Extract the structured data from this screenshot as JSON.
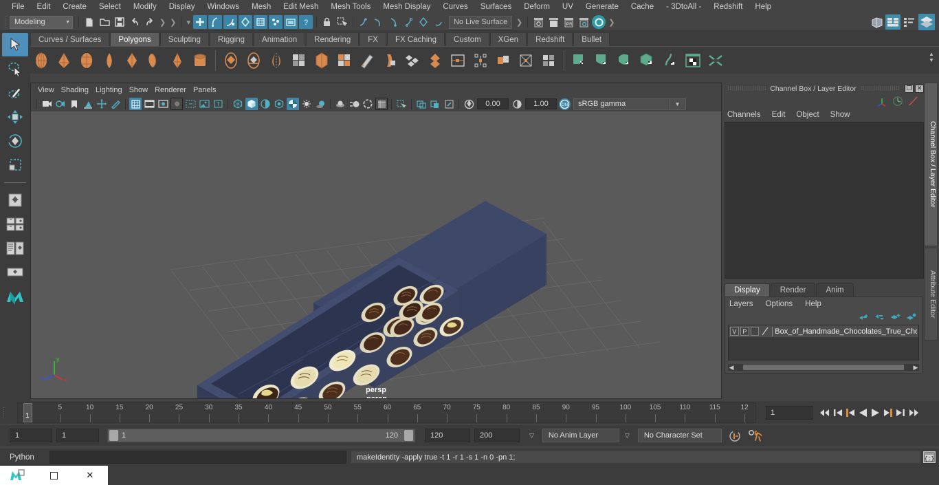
{
  "app": {
    "name": "Autodesk Maya",
    "viewport_camera_label": "persp"
  },
  "menubar": {
    "items": [
      "File",
      "Edit",
      "Create",
      "Select",
      "Modify",
      "Display",
      "Windows",
      "Mesh",
      "Edit Mesh",
      "Mesh Tools",
      "Mesh Display",
      "Curves",
      "Surfaces",
      "Deform",
      "UV",
      "Generate",
      "Cache",
      "- 3DtoAll -",
      "Redshift",
      "Help"
    ]
  },
  "statusbar": {
    "workspace": "Modeling",
    "live_surface": "No Live Surface",
    "icons": [
      "new-scene-icon",
      "open-scene-icon",
      "save-scene-icon",
      "undo-icon",
      "redo-icon",
      "select-by-hierarchy-icon",
      "select-by-object-icon",
      "select-by-component-icon",
      "snap-grid-icon",
      "snap-curve-icon",
      "snap-point-icon",
      "snap-projected-icon",
      "snap-view-plane-icon",
      "make-live-icon",
      "lock-icon",
      "selection-mask-icon",
      "render-current-frame-icon",
      "ipr-render-icon",
      "render-settings-icon",
      "hypershade-icon",
      "render-view-icon",
      "show-hide-editors-icon",
      "attribute-editor-toggle-icon",
      "tool-settings-toggle-icon",
      "channel-box-toggle-icon"
    ]
  },
  "shelf": {
    "tabs": [
      "Curves / Surfaces",
      "Polygons",
      "Sculpting",
      "Rigging",
      "Animation",
      "Rendering",
      "FX",
      "FX Caching",
      "Custom",
      "XGen",
      "Redshift",
      "Bullet"
    ],
    "active_tab": "Polygons",
    "buttons": [
      "poly-sphere-icon",
      "poly-cone-icon",
      "poly-cube-icon",
      "poly-cylinder-icon",
      "poly-torus-icon",
      "poly-plane-icon",
      "poly-pyramid-icon",
      "poly-pipe-icon",
      "poly-boolean-union-icon",
      "poly-boolean-difference-icon",
      "poly-mirror-icon",
      "poly-combine-icon",
      "poly-smooth-icon",
      "poly-multi-cut-icon",
      "poly-sculpt-icon",
      "poly-extrude-icon",
      "poly-bevel-icon",
      "poly-bridge-icon",
      "poly-merge-icon",
      "poly-append-icon",
      "poly-wedge-icon",
      "poly-duplicate-face-icon",
      "poly-transform-icon",
      "poly-quad-draw-icon",
      "uv-planar-icon",
      "uv-cylindrical-icon",
      "uv-spherical-icon",
      "uv-automatic-icon",
      "uv-unfold-icon",
      "uv-editor-icon",
      "uv-layout-icon"
    ]
  },
  "left_toolbar": {
    "items": [
      "select-tool-icon",
      "lasso-select-tool-icon",
      "paint-select-tool-icon",
      "move-tool-icon",
      "rotate-tool-icon",
      "scale-tool-icon",
      "last-tool-used-icon",
      "single-pane-layout-icon",
      "two-pane-layout-icon",
      "three-pane-layout-icon",
      "four-pane-layout-icon",
      "outliner-persp-layout-icon",
      "persp-graph-layout-icon",
      "maya-logo-icon"
    ],
    "active": "select-tool-icon"
  },
  "viewport": {
    "menus": [
      "View",
      "Shading",
      "Lighting",
      "Show",
      "Renderer",
      "Panels"
    ],
    "toolbar_icons": [
      "select-camera-icon",
      "camera-attributes-icon",
      "bookmark-icon",
      "image-plane-icon",
      "two-d-pan-zoom-icon",
      "grease-pencil-icon",
      "grid-toggle-icon",
      "film-gate-icon",
      "resolution-gate-icon",
      "gate-mask-icon",
      "film-origin-icon",
      "safe-action-icon",
      "text-overlay-icon",
      "wireframe-icon",
      "smooth-shade-all-icon",
      "shaded-wireframe-icon",
      "use-default-material-icon",
      "textured-icon",
      "use-all-lights-icon",
      "shadows-icon",
      "screen-space-ao-icon",
      "motion-blur-icon",
      "isolate-select-icon",
      "xray-icon",
      "xray-joints-icon",
      "xray-active-components-icon",
      "exposure-icon",
      "gamma-icon",
      "color-management-toggle-icon"
    ],
    "exposure_value": "0.00",
    "gamma_value": "1.00",
    "color_management_state": "ON",
    "color_profile": "sRGB gamma",
    "camera_label": "persp",
    "axis_gizmo": {
      "x": "x",
      "y": "y",
      "z": "z"
    },
    "scene": {
      "object": "Box of Handmade Chocolates",
      "box_color": "#3a4463",
      "box_shade_top": "#434e70",
      "box_shade_side": "#2e3754",
      "background": "#5a5a5a",
      "grid_color": "#6c6c6c",
      "chocolates": [
        {
          "type": "dark-truffle",
          "fill": "#3a2317",
          "accent": "#7a5032"
        },
        {
          "type": "cream-square",
          "fill": "#e8e0bb",
          "accent": "#c8bb88"
        },
        {
          "type": "milk-dome",
          "fill": "#5b3a22",
          "accent": "#8a6038"
        },
        {
          "type": "white-drizzle",
          "fill": "#efe8c6",
          "accent": "#6d4a2c"
        },
        {
          "type": "yellow-butter",
          "fill": "#e8d98a",
          "accent": "#b79c4c"
        }
      ]
    }
  },
  "right_panel": {
    "title": "Channel Box / Layer Editor",
    "window_buttons": [
      "restore-icon",
      "close-icon"
    ],
    "quick_icons": [
      "axis-gizmo-icon",
      "time-slider-icon",
      "curve-icon"
    ],
    "channel_menus": [
      "Channels",
      "Edit",
      "Object",
      "Show"
    ],
    "layer_tabs": [
      "Display",
      "Render",
      "Anim"
    ],
    "active_layer_tab": "Display",
    "layer_menus": [
      "Layers",
      "Options",
      "Help"
    ],
    "layer_arrow_icons": [
      "move-layer-up-icon",
      "move-layer-down-icon",
      "new-layer-icon",
      "new-layer-from-selected-icon"
    ],
    "layers": [
      {
        "visibility": "V",
        "playback": "P",
        "shading": "",
        "name": "Box_of_Handmade_Chocolates_True_Cho"
      }
    ]
  },
  "vertical_tabs": {
    "items": [
      "Channel Box / Layer Editor",
      "Attribute Editor"
    ],
    "active": "Channel Box / Layer Editor"
  },
  "timeline": {
    "start": 1,
    "end": 120,
    "current_frame": "1",
    "tick_labels": [
      "5",
      "10",
      "15",
      "20",
      "25",
      "30",
      "35",
      "40",
      "45",
      "50",
      "55",
      "60",
      "65",
      "70",
      "75",
      "80",
      "85",
      "90",
      "95",
      "100",
      "105",
      "110",
      "115",
      "12"
    ],
    "transport_icons": [
      "go-to-start-icon",
      "step-back-key-icon",
      "step-back-frame-icon",
      "play-backwards-icon",
      "play-forwards-icon",
      "step-forward-frame-icon",
      "step-forward-key-icon",
      "go-to-end-icon"
    ]
  },
  "range_bar": {
    "anim_start": "1",
    "range_start": "1",
    "slider_left_label": "1",
    "slider_right_label": "120",
    "range_end": "120",
    "anim_end": "200",
    "anim_layer": "No Anim Layer",
    "character_set": "No Character Set",
    "auto_key_icon": "auto-keyframe-icon",
    "anim_prefs_icon": "animation-preferences-icon"
  },
  "command_line": {
    "language": "Python",
    "input_value": "",
    "output": "makeIdentity -apply true -t 1 -r 1 -s 1 -n 0 -pn 1;",
    "script_editor_icon": "script-editor-icon"
  },
  "taskbar": {
    "buttons": [
      "maya-app-icon",
      "restore-window-icon",
      "close-window-icon"
    ]
  },
  "colors": {
    "accent_blue": "#3f86a8",
    "shelf_orange": "#d98a4f",
    "shelf_green": "#5fa98c",
    "panel_bg": "#444444",
    "dark_bg": "#333333",
    "selected_tool": "#4f8fbb"
  }
}
